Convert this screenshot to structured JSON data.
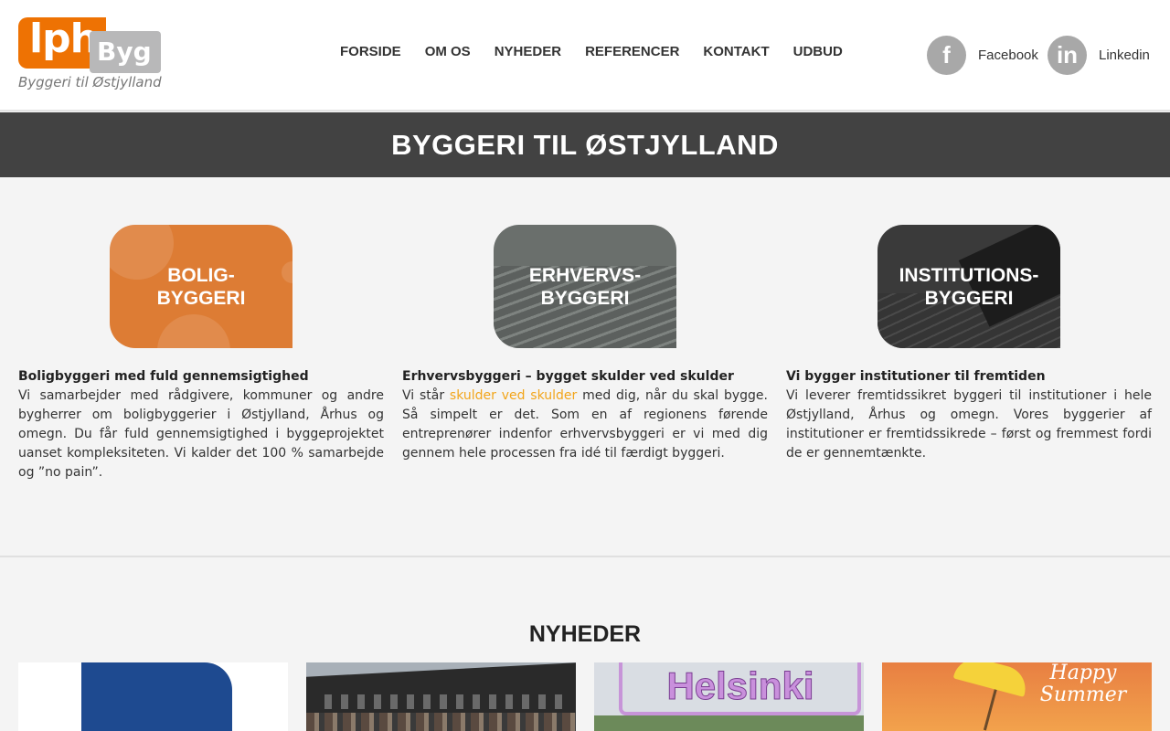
{
  "logo": {
    "main": "lph",
    "secondary": "Byg",
    "tagline": "Byggeri til Østjylland"
  },
  "nav": {
    "items": [
      "FORSIDE",
      "OM OS",
      "NYHEDER",
      "REFERENCER",
      "KONTAKT",
      "UDBUD"
    ]
  },
  "social": {
    "facebook_label": "Facebook",
    "facebook_glyph": "f",
    "linkedin_label": "Linkedin",
    "linkedin_glyph": "in"
  },
  "banner": {
    "title": "BYGGERI TIL ØSTJYLLAND"
  },
  "services": [
    {
      "tile_label": "BOLIG-\nBYGGERI",
      "heading": "Boligbyggeri med fuld gennemsigtighed",
      "text": "Vi samarbejder med rådgivere, kommuner og andre bygherrer om boligbyggerier i Østjylland, Århus og omegn. Du får fuld gennemsigtighed i byggeprojektet uanset kompleksiteten. Vi kalder det 100 % samarbejde og ”no pain”."
    },
    {
      "tile_label": "ERHVERVS-\nBYGGERI",
      "heading": "Erhvervsbyggeri – bygget skulder ved skulder",
      "text_before": "Vi står ",
      "highlight": "skulder ved skulder",
      "text_after": " med dig, når du skal bygge. Så simpelt er det. Som en af regionens førende entreprenører indenfor erhvervsbyggeri er vi med dig gennem hele processen fra idé til færdigt byggeri."
    },
    {
      "tile_label": "INSTITUTIONS-\nBYGGERI",
      "heading": "Vi bygger institutioner til fremtiden",
      "text": "Vi leverer fremtidssikret byggeri til institutioner i hele Østjylland, Århus og omegn. Vores byggerier af institutioner er fremtidssikrede – først og fremmest fordi de er gennemtænkte."
    }
  ],
  "news": {
    "title": "NYHEDER",
    "card_3_sign": "Helsinki",
    "card_4_text": "Happy Summer"
  },
  "colors": {
    "brand_orange": "#ee7203",
    "logo_grey": "#b8b8b9",
    "banner_bg": "#424242",
    "link_highlight": "#f2a51a"
  }
}
